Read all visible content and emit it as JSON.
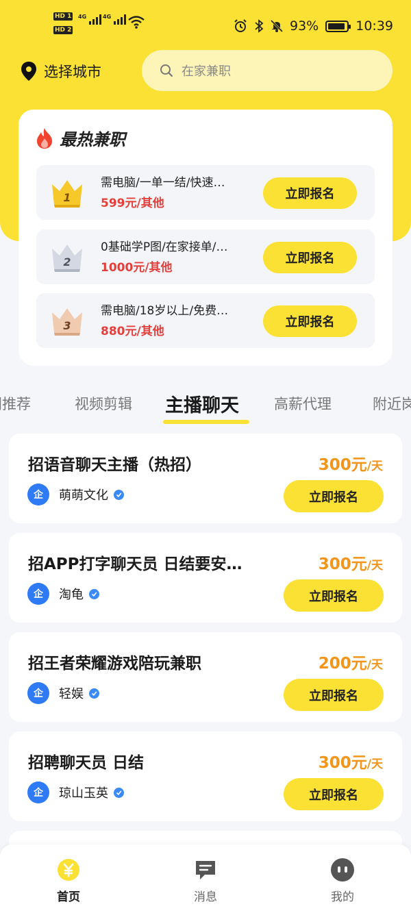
{
  "status_bar": {
    "hd1": "HD 1",
    "hd2": "HD 2",
    "net1": "4G",
    "net2": "4G",
    "battery": "93%",
    "battery_level": 0.93,
    "time": "10:39"
  },
  "header": {
    "city_label": "选择城市",
    "search_placeholder": "在家兼职"
  },
  "hot": {
    "title": "最热兼职",
    "items": [
      {
        "rank": "1",
        "name": "需电脑/一单一结/快速…",
        "price": "599元/其他",
        "button": "立即报名"
      },
      {
        "rank": "2",
        "name": "0基础学P图/在家接单/…",
        "price": "1000元/其他",
        "button": "立即报名"
      },
      {
        "rank": "3",
        "name": "需电脑/18岁以上/免费…",
        "price": "880元/其他",
        "button": "立即报名"
      }
    ]
  },
  "tabs": [
    "门推荐",
    "视频剪辑",
    "主播聊天",
    "高薪代理",
    "附近岗"
  ],
  "active_tab": "主播聊天",
  "jobs": [
    {
      "title": "招语音聊天主播（热招）",
      "amount": "300元",
      "unit": "/天",
      "company": "萌萌文化",
      "badge": "企",
      "button": "立即报名"
    },
    {
      "title": "招APP打字聊天员 日结要安…",
      "amount": "300元",
      "unit": "/天",
      "company": "淘龟",
      "badge": "企",
      "button": "立即报名"
    },
    {
      "title": "招王者荣耀游戏陪玩兼职",
      "amount": "200元",
      "unit": "/天",
      "company": "轻娱",
      "badge": "企",
      "button": "立即报名"
    },
    {
      "title": "招聘聊天员 日结",
      "amount": "300元",
      "unit": "/天",
      "company": "琼山玉英",
      "badge": "企",
      "button": "立即报名"
    }
  ],
  "nav": [
    {
      "label": "首页",
      "icon": "yuan-coin-icon"
    },
    {
      "label": "消息",
      "icon": "message-icon"
    },
    {
      "label": "我的",
      "icon": "profile-face-icon"
    }
  ],
  "colors": {
    "brand_yellow": "#fbe134",
    "price_red": "#e3403c",
    "salary_orange": "#f2951a",
    "company_blue": "#2f7bf6"
  }
}
